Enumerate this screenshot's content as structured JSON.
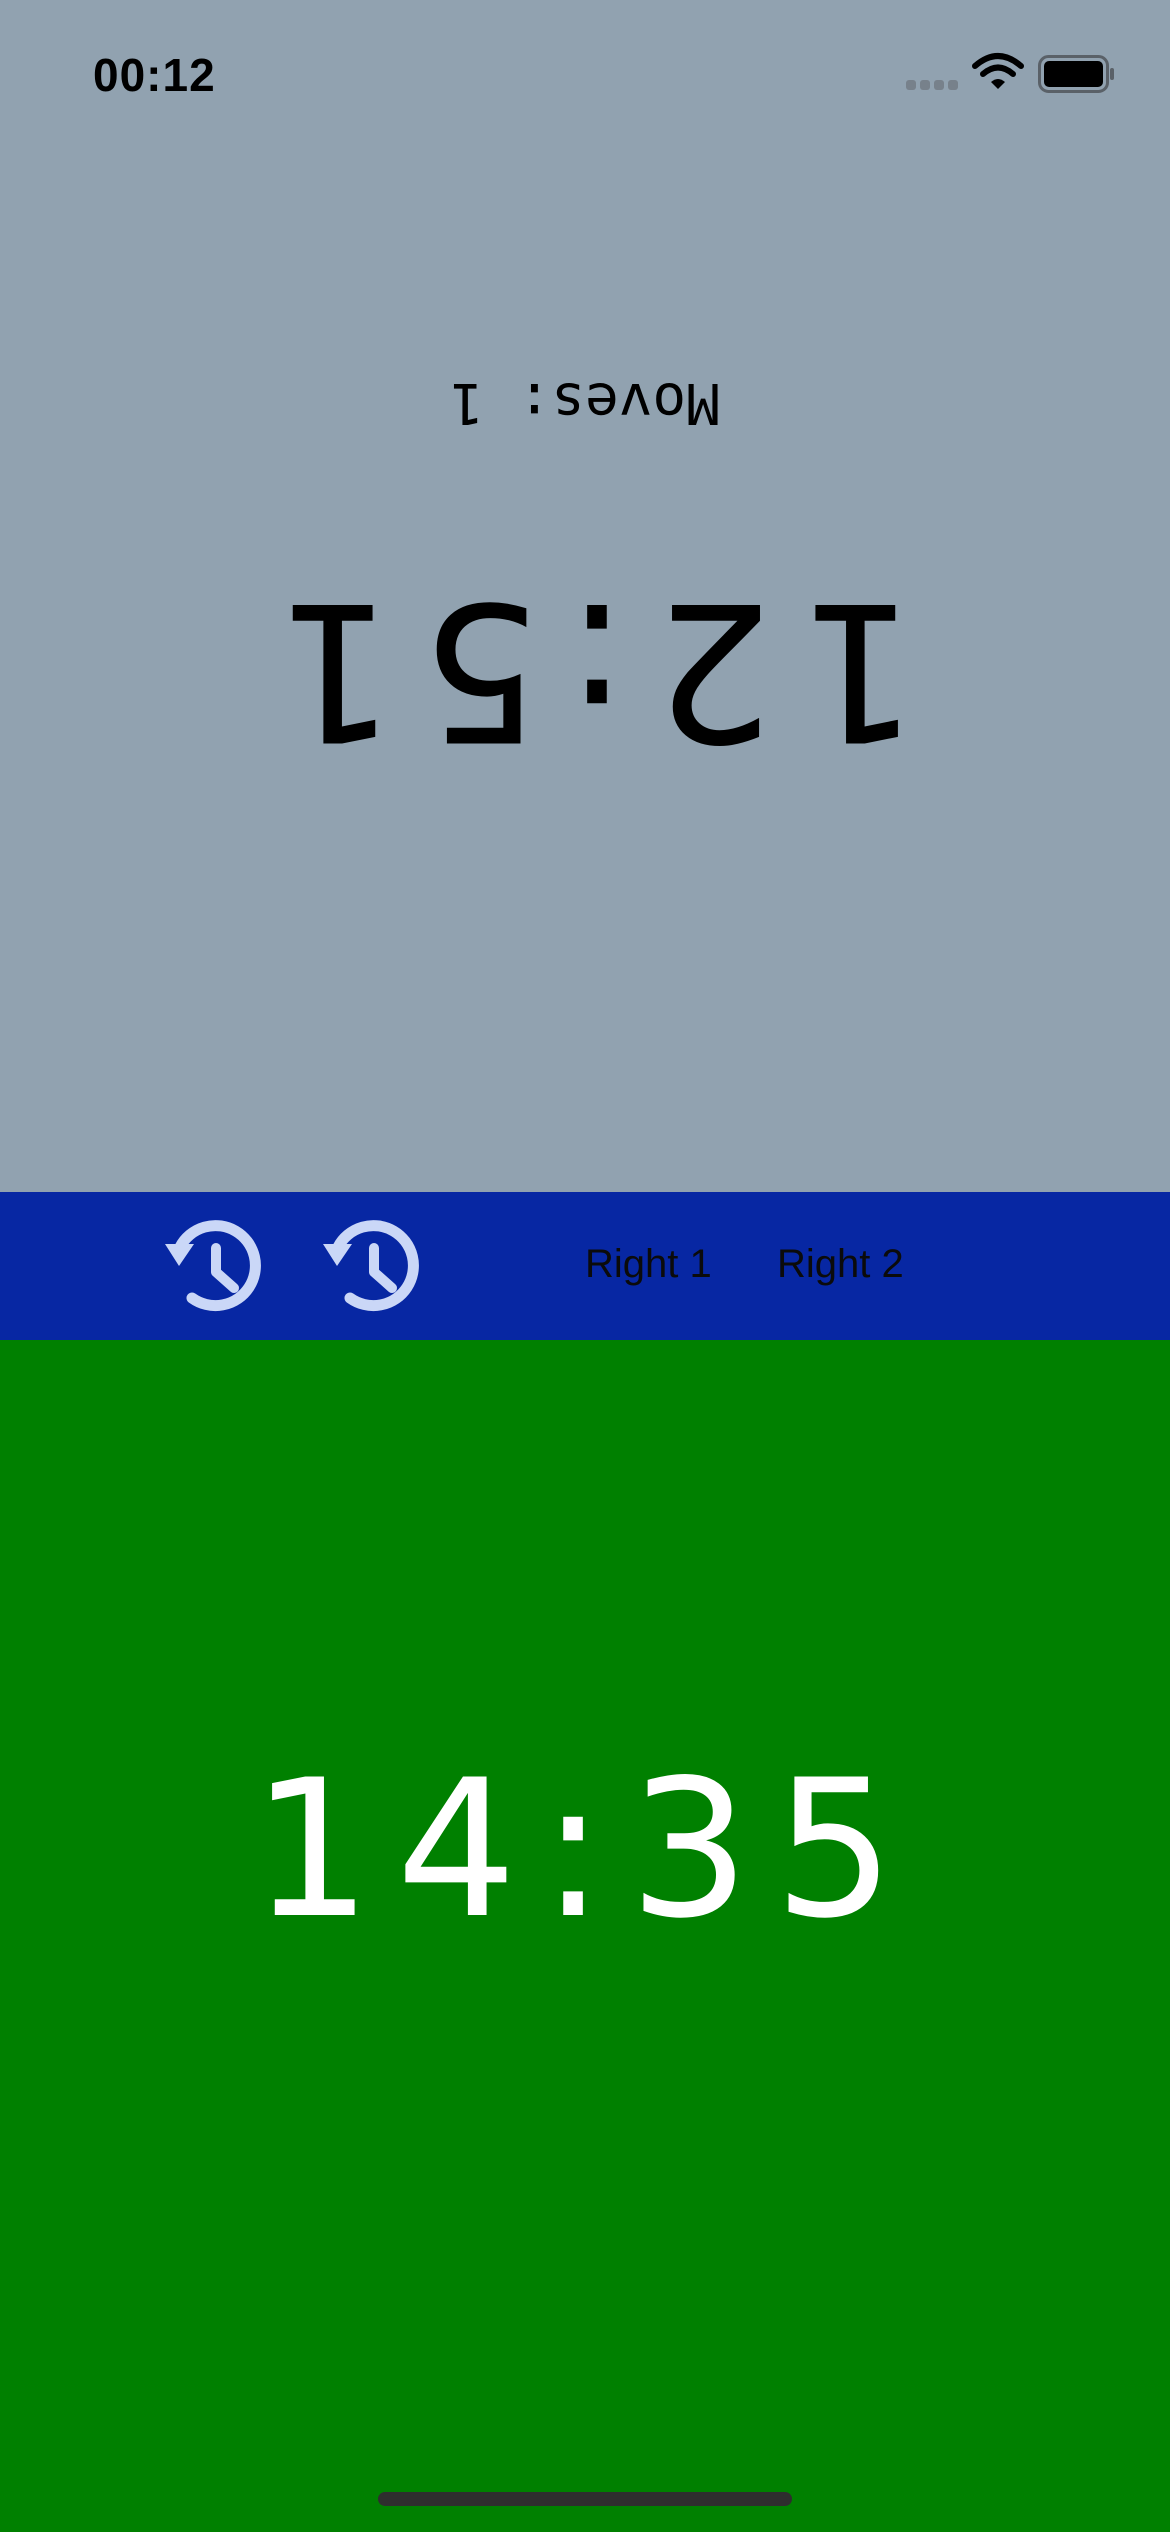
{
  "status_bar": {
    "time": "00:12",
    "signal_icon": "cellular-signal-icon",
    "wifi_icon": "wifi-icon",
    "battery_icon": "battery-icon"
  },
  "top_player": {
    "moves_text": "Moves: 1",
    "clock": "12:51",
    "background_color": "#91a2b0",
    "text_color": "#000000"
  },
  "toolbar": {
    "background_color": "#0727a3",
    "icon_color": "#cad7f7",
    "undo_icon": "history-icon",
    "right1_label": "Right 1",
    "right2_label": "Right 2"
  },
  "bottom_player": {
    "clock": "14:35",
    "background_color": "#008000",
    "text_color": "#ffffff"
  }
}
